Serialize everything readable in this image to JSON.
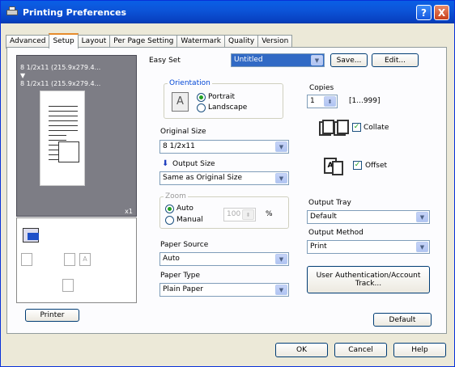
{
  "window": {
    "title": "Printing Preferences",
    "help": "?",
    "close": "X"
  },
  "tabs": [
    "Advanced",
    "Setup",
    "Layout",
    "Per Page Setting",
    "Watermark",
    "Quality",
    "Version"
  ],
  "active_tab": "Setup",
  "preview": {
    "line1": "8 1/2x11 (215.9x279.4...",
    "arrow": "▼",
    "line2": "8 1/2x11 (215.9x279.4...",
    "copies_badge": "x1"
  },
  "printer_button": "Printer",
  "easy_set": {
    "label": "Easy Set",
    "value": "Untitled",
    "save": "Save...",
    "edit": "Edit..."
  },
  "orientation": {
    "title": "Orientation",
    "portrait": "Portrait",
    "landscape": "Landscape",
    "icon": "A"
  },
  "original_size": {
    "label": "Original Size",
    "value": "8 1/2x11"
  },
  "output_size": {
    "label": "Output Size",
    "value": "Same as Original Size"
  },
  "zoom": {
    "title": "Zoom",
    "auto": "Auto",
    "manual": "Manual",
    "value": "100",
    "unit": "%"
  },
  "paper_source": {
    "label": "Paper Source",
    "value": "Auto"
  },
  "paper_type": {
    "label": "Paper Type",
    "value": "Plain Paper"
  },
  "copies": {
    "label": "Copies",
    "value": "1",
    "range": "[1...999]"
  },
  "collate": {
    "label": "Collate"
  },
  "offset": {
    "label": "Offset"
  },
  "output_tray": {
    "label": "Output Tray",
    "value": "Default"
  },
  "output_method": {
    "label": "Output Method",
    "value": "Print"
  },
  "user_auth_button": {
    "line1": "User Authentication/Account",
    "line2": "Track..."
  },
  "default_button": "Default",
  "footer": {
    "ok": "OK",
    "cancel": "Cancel",
    "help": "Help"
  }
}
